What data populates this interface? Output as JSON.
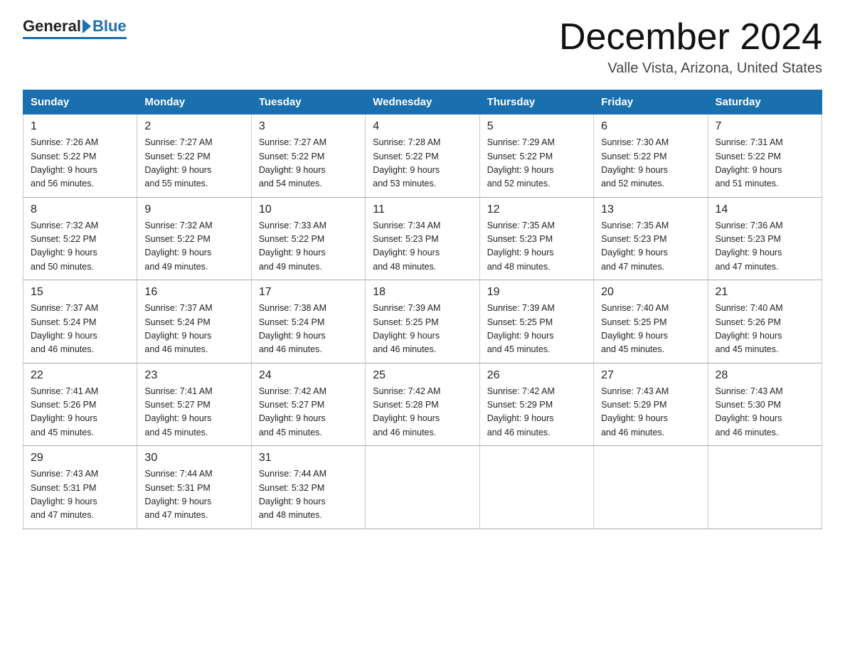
{
  "header": {
    "logo_general": "General",
    "logo_blue": "Blue",
    "month_title": "December 2024",
    "location": "Valle Vista, Arizona, United States"
  },
  "days_of_week": [
    "Sunday",
    "Monday",
    "Tuesday",
    "Wednesday",
    "Thursday",
    "Friday",
    "Saturday"
  ],
  "weeks": [
    [
      {
        "day": "1",
        "sunrise": "7:26 AM",
        "sunset": "5:22 PM",
        "daylight": "9 hours and 56 minutes."
      },
      {
        "day": "2",
        "sunrise": "7:27 AM",
        "sunset": "5:22 PM",
        "daylight": "9 hours and 55 minutes."
      },
      {
        "day": "3",
        "sunrise": "7:27 AM",
        "sunset": "5:22 PM",
        "daylight": "9 hours and 54 minutes."
      },
      {
        "day": "4",
        "sunrise": "7:28 AM",
        "sunset": "5:22 PM",
        "daylight": "9 hours and 53 minutes."
      },
      {
        "day": "5",
        "sunrise": "7:29 AM",
        "sunset": "5:22 PM",
        "daylight": "9 hours and 52 minutes."
      },
      {
        "day": "6",
        "sunrise": "7:30 AM",
        "sunset": "5:22 PM",
        "daylight": "9 hours and 52 minutes."
      },
      {
        "day": "7",
        "sunrise": "7:31 AM",
        "sunset": "5:22 PM",
        "daylight": "9 hours and 51 minutes."
      }
    ],
    [
      {
        "day": "8",
        "sunrise": "7:32 AM",
        "sunset": "5:22 PM",
        "daylight": "9 hours and 50 minutes."
      },
      {
        "day": "9",
        "sunrise": "7:32 AM",
        "sunset": "5:22 PM",
        "daylight": "9 hours and 49 minutes."
      },
      {
        "day": "10",
        "sunrise": "7:33 AM",
        "sunset": "5:22 PM",
        "daylight": "9 hours and 49 minutes."
      },
      {
        "day": "11",
        "sunrise": "7:34 AM",
        "sunset": "5:23 PM",
        "daylight": "9 hours and 48 minutes."
      },
      {
        "day": "12",
        "sunrise": "7:35 AM",
        "sunset": "5:23 PM",
        "daylight": "9 hours and 48 minutes."
      },
      {
        "day": "13",
        "sunrise": "7:35 AM",
        "sunset": "5:23 PM",
        "daylight": "9 hours and 47 minutes."
      },
      {
        "day": "14",
        "sunrise": "7:36 AM",
        "sunset": "5:23 PM",
        "daylight": "9 hours and 47 minutes."
      }
    ],
    [
      {
        "day": "15",
        "sunrise": "7:37 AM",
        "sunset": "5:24 PM",
        "daylight": "9 hours and 46 minutes."
      },
      {
        "day": "16",
        "sunrise": "7:37 AM",
        "sunset": "5:24 PM",
        "daylight": "9 hours and 46 minutes."
      },
      {
        "day": "17",
        "sunrise": "7:38 AM",
        "sunset": "5:24 PM",
        "daylight": "9 hours and 46 minutes."
      },
      {
        "day": "18",
        "sunrise": "7:39 AM",
        "sunset": "5:25 PM",
        "daylight": "9 hours and 46 minutes."
      },
      {
        "day": "19",
        "sunrise": "7:39 AM",
        "sunset": "5:25 PM",
        "daylight": "9 hours and 45 minutes."
      },
      {
        "day": "20",
        "sunrise": "7:40 AM",
        "sunset": "5:25 PM",
        "daylight": "9 hours and 45 minutes."
      },
      {
        "day": "21",
        "sunrise": "7:40 AM",
        "sunset": "5:26 PM",
        "daylight": "9 hours and 45 minutes."
      }
    ],
    [
      {
        "day": "22",
        "sunrise": "7:41 AM",
        "sunset": "5:26 PM",
        "daylight": "9 hours and 45 minutes."
      },
      {
        "day": "23",
        "sunrise": "7:41 AM",
        "sunset": "5:27 PM",
        "daylight": "9 hours and 45 minutes."
      },
      {
        "day": "24",
        "sunrise": "7:42 AM",
        "sunset": "5:27 PM",
        "daylight": "9 hours and 45 minutes."
      },
      {
        "day": "25",
        "sunrise": "7:42 AM",
        "sunset": "5:28 PM",
        "daylight": "9 hours and 46 minutes."
      },
      {
        "day": "26",
        "sunrise": "7:42 AM",
        "sunset": "5:29 PM",
        "daylight": "9 hours and 46 minutes."
      },
      {
        "day": "27",
        "sunrise": "7:43 AM",
        "sunset": "5:29 PM",
        "daylight": "9 hours and 46 minutes."
      },
      {
        "day": "28",
        "sunrise": "7:43 AM",
        "sunset": "5:30 PM",
        "daylight": "9 hours and 46 minutes."
      }
    ],
    [
      {
        "day": "29",
        "sunrise": "7:43 AM",
        "sunset": "5:31 PM",
        "daylight": "9 hours and 47 minutes."
      },
      {
        "day": "30",
        "sunrise": "7:44 AM",
        "sunset": "5:31 PM",
        "daylight": "9 hours and 47 minutes."
      },
      {
        "day": "31",
        "sunrise": "7:44 AM",
        "sunset": "5:32 PM",
        "daylight": "9 hours and 48 minutes."
      },
      null,
      null,
      null,
      null
    ]
  ],
  "labels": {
    "sunrise_prefix": "Sunrise: ",
    "sunset_prefix": "Sunset: ",
    "daylight_prefix": "Daylight: "
  }
}
